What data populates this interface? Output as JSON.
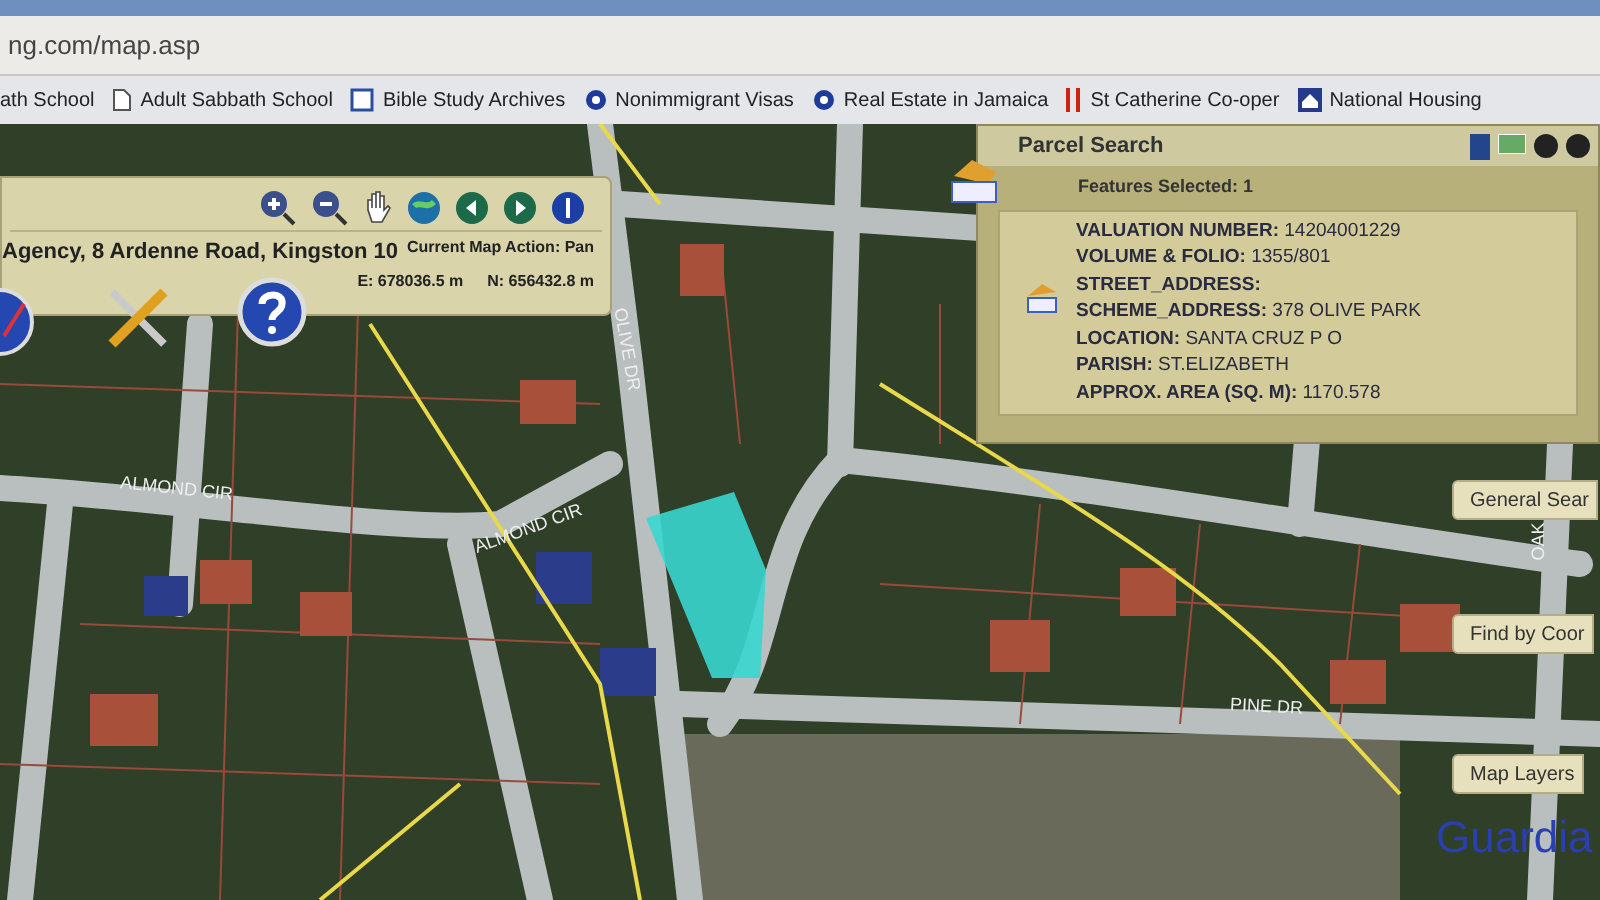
{
  "browser": {
    "address": "ng.com/map.asp",
    "bookmarks": [
      {
        "label": "ath School"
      },
      {
        "label": "Adult Sabbath School"
      },
      {
        "label": "Bible Study Archives"
      },
      {
        "label": "Nonimmigrant Visas"
      },
      {
        "label": "Real Estate in Jamaica"
      },
      {
        "label": "St Catherine Co-oper"
      },
      {
        "label": "National Housing"
      }
    ]
  },
  "toolbar": {
    "title": "Agency, 8 Ardenne Road, Kingston 10",
    "map_action": "Current Map Action: Pan",
    "easting": "E: 678036.5 m",
    "northing": "N: 656432.8 m"
  },
  "parcel_panel": {
    "title": "Parcel Search",
    "features": "Features Selected: 1",
    "fields": [
      {
        "label": "VALUATION NUMBER:",
        "value": "14204001229"
      },
      {
        "label": "VOLUME & FOLIO:",
        "value": "1355/801"
      },
      {
        "label": "STREET_ADDRESS:"
      },
      {
        "label": "SCHEME_ADDRESS:",
        "value": "378 OLIVE PARK"
      },
      {
        "label": "LOCATION:",
        "value": "SANTA CRUZ P O"
      },
      {
        "label": "PARISH:",
        "value": "ST.ELIZABETH"
      },
      {
        "label": "APPROX. AREA (SQ. M):",
        "value": "1170.578"
      }
    ]
  },
  "side_buttons": [
    "General Sear",
    "Find by Coor",
    "Map Layers"
  ],
  "map_labels": [
    "ALMOND CIR",
    "ALMOND CIR",
    "OLIVE DR",
    "PINE DR",
    "OAK",
    "Guardia"
  ]
}
